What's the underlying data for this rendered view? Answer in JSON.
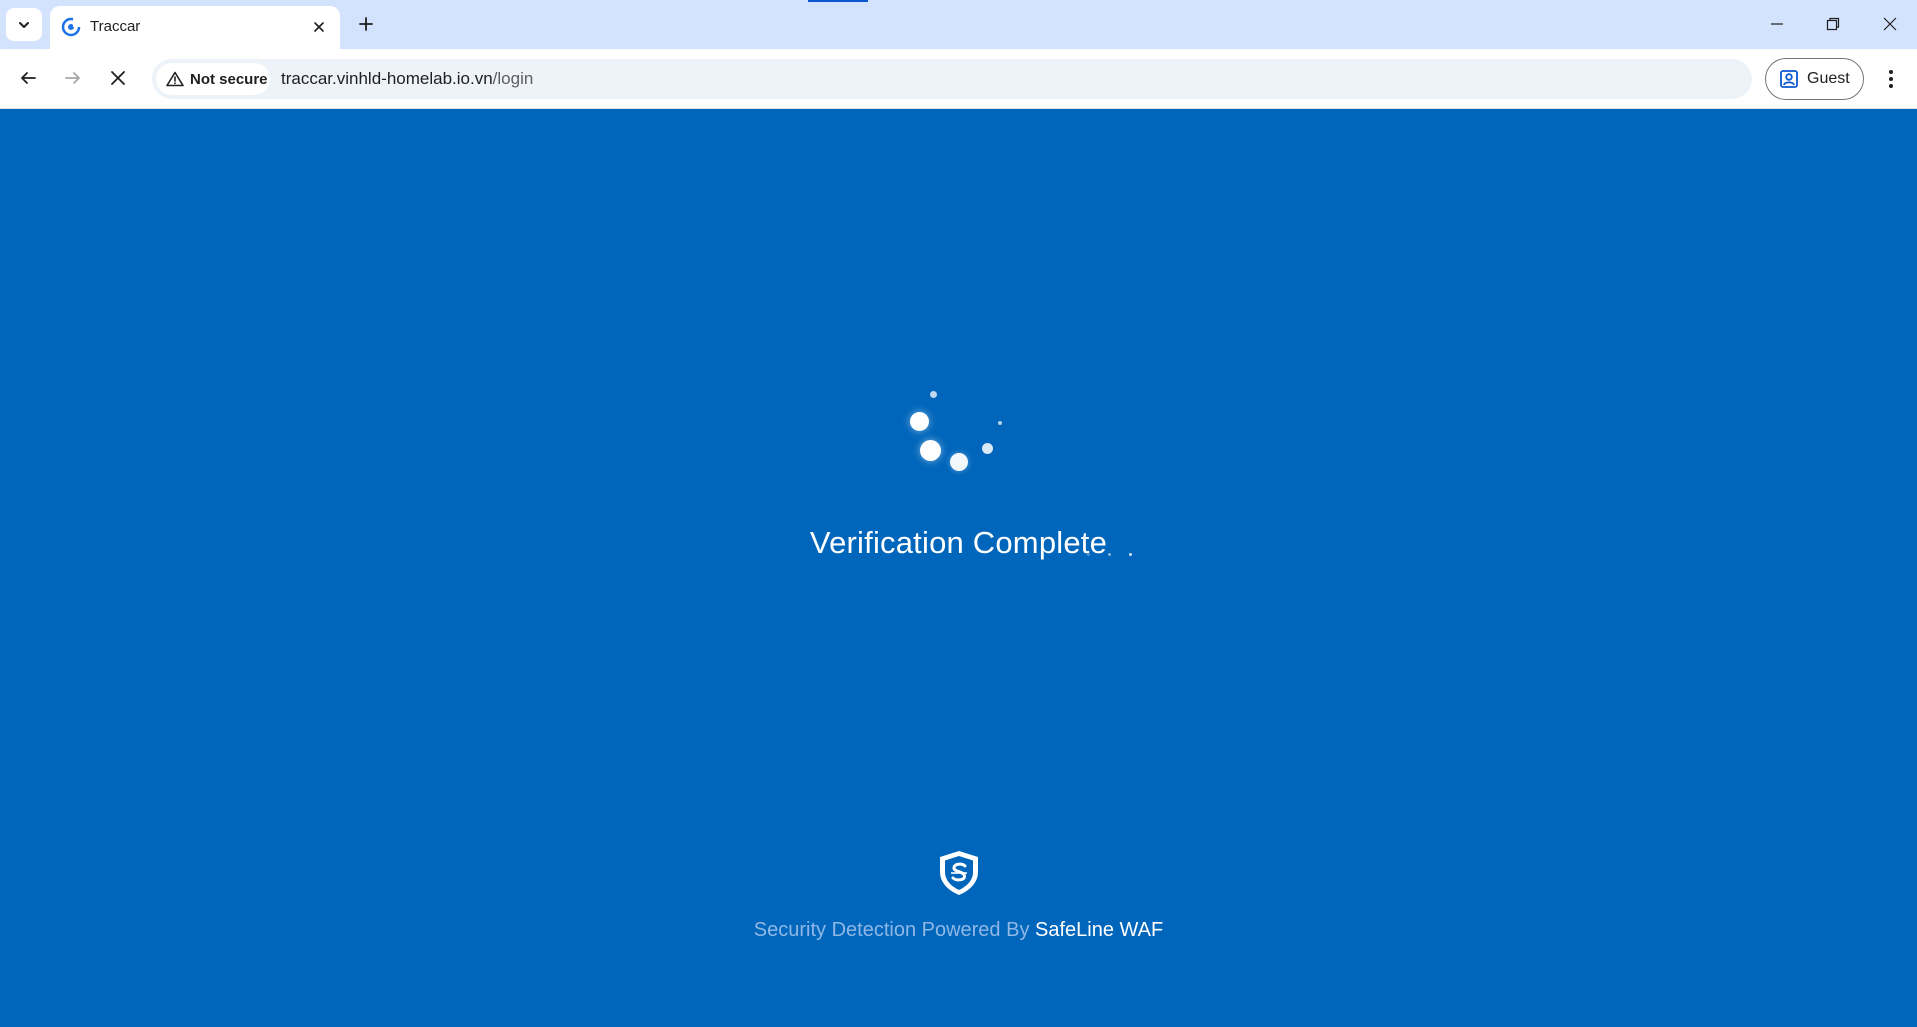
{
  "browser": {
    "tab": {
      "title": "Traccar"
    },
    "omnibox": {
      "security_label": "Not secure",
      "url_host": "traccar.vinhld-homelab.io.vn",
      "url_path": "/login"
    },
    "profile": {
      "label": "Guest"
    }
  },
  "page": {
    "status_text": "Verification Complete",
    "footer_prefix": "Security Detection Powered By",
    "footer_brand": "SafeLine WAF"
  },
  "colors": {
    "background": "#0066bb",
    "tabstrip": "#d3e3fd",
    "accent": "#0b57d0"
  }
}
